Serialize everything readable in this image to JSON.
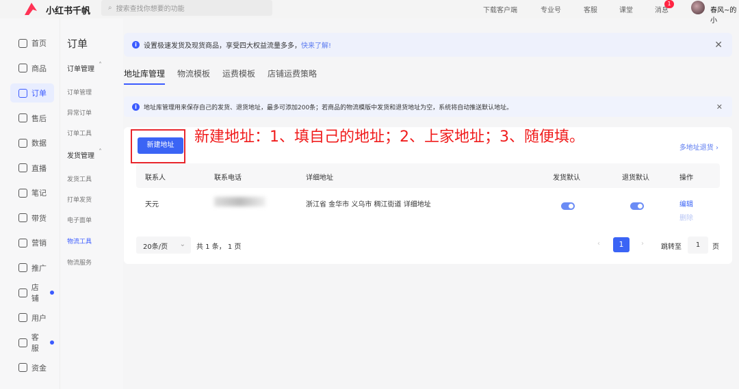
{
  "topbar": {
    "brand": "小红书千帆",
    "search_placeholder": "搜索查找你想要的功能",
    "links": [
      "下载客户端",
      "专业号",
      "客服",
      "课堂",
      "消息"
    ],
    "message_badge": "1",
    "user": "春风~的小"
  },
  "sidebar": {
    "items": [
      {
        "label": "首页",
        "icon": "home-icon"
      },
      {
        "label": "商品",
        "icon": "bag-icon"
      },
      {
        "label": "订单",
        "icon": "order-icon",
        "active": true
      },
      {
        "label": "售后",
        "icon": "aftersale-icon"
      },
      {
        "label": "数据",
        "icon": "chart-icon"
      },
      {
        "label": "直播",
        "icon": "live-icon"
      },
      {
        "label": "笔记",
        "icon": "book-icon"
      },
      {
        "label": "带货",
        "icon": "goods-icon"
      },
      {
        "label": "营销",
        "icon": "megaphone-icon"
      },
      {
        "label": "推广",
        "icon": "promote-icon"
      },
      {
        "label": "店铺",
        "icon": "store-icon",
        "dot": true
      },
      {
        "label": "用户",
        "icon": "users-icon"
      },
      {
        "label": "客服",
        "icon": "service-icon",
        "dot": true
      },
      {
        "label": "资金",
        "icon": "wallet-icon"
      }
    ]
  },
  "subnav": {
    "title": "订单",
    "groups": [
      {
        "label": "订单管理",
        "items": [
          "订单管理",
          "异常订单",
          "订单工具"
        ]
      },
      {
        "label": "发货管理",
        "items": [
          "发货工具",
          "打单发货",
          "电子面单",
          "物流工具",
          "物流服务"
        ]
      }
    ],
    "active": "物流工具"
  },
  "banner": {
    "text": "设置极速发货及现货商品，享受四大权益流量多多，",
    "link": "快来了解!"
  },
  "tabs": [
    {
      "label": "地址库管理",
      "active": true
    },
    {
      "label": "物流模板"
    },
    {
      "label": "运费模板"
    },
    {
      "label": "店铺运费策略"
    }
  ],
  "notice": "地址库管理用来保存自己的发货、退货地址，最多可添加200条；若商品的物流模版中发货和退货地址为空，系统将自动推送默认地址。",
  "card": {
    "new_button": "新建地址",
    "annotation": "新建地址：1、填自己的地址；2、上家地址；3、随便填。",
    "multi_link": "多地址退货",
    "columns": [
      "联系人",
      "联系电话",
      "详细地址",
      "发货默认",
      "退货默认",
      "操作"
    ],
    "rows": [
      {
        "contact": "天元",
        "address": "浙江省 金华市 义乌市 稠江街道 详细地址",
        "ship_default": true,
        "return_default": true,
        "actions": [
          "编辑",
          "删除"
        ]
      }
    ],
    "pagination": {
      "page_size": "20条/页",
      "summary": "共 1 条， 1 页",
      "current": "1",
      "jump_label": "跳转至",
      "jump_value": "1",
      "page_suffix": "页"
    }
  },
  "colors": {
    "accent": "#3b64f5",
    "annotation": "#f01c1c"
  }
}
